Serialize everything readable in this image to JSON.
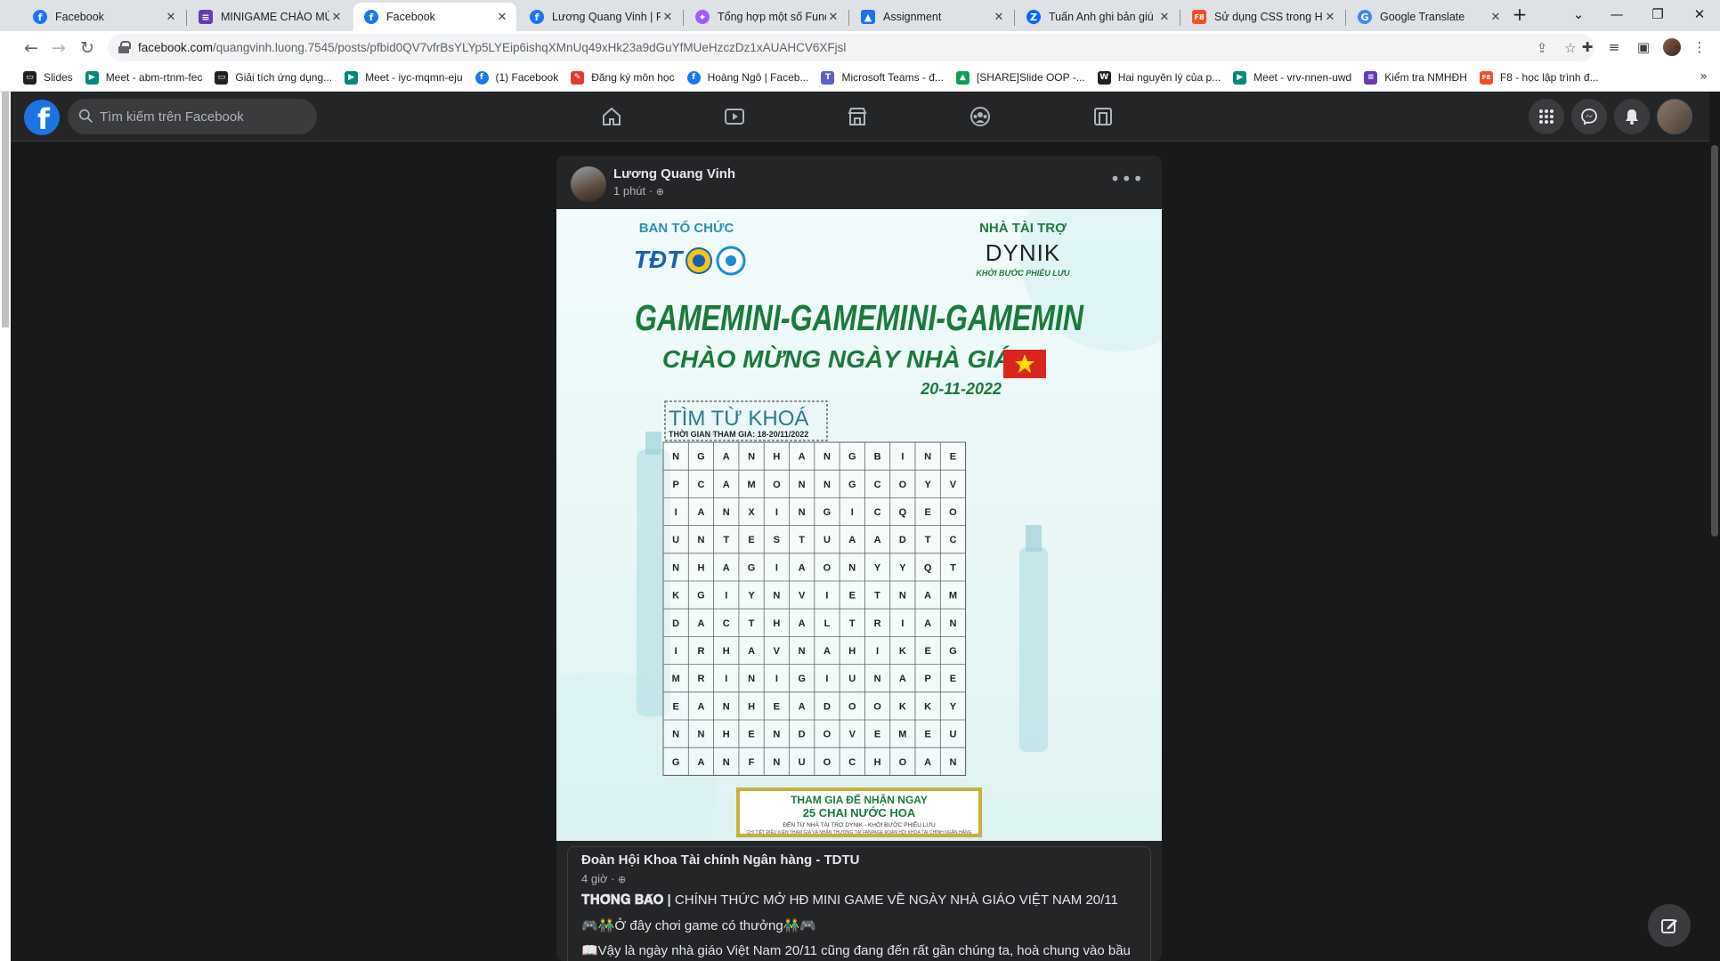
{
  "browser": {
    "tabs": [
      {
        "title": "Facebook",
        "icon": "facebook-icon",
        "color": "#1877f2"
      },
      {
        "title": "MINIGAME CHÀO MỪ",
        "icon": "form-icon",
        "color": "#673ab7"
      },
      {
        "title": "Facebook",
        "icon": "facebook-icon",
        "color": "#1877f2",
        "active": true
      },
      {
        "title": "Lương Quang Vinh | Fa",
        "icon": "facebook-icon",
        "color": "#1877f2"
      },
      {
        "title": "Tổng hợp một số Func",
        "icon": "figma-icon",
        "color": "#a259ff"
      },
      {
        "title": "Assignment",
        "icon": "classroom-icon",
        "color": "#1a73e8"
      },
      {
        "title": "Tuấn Anh ghi bản giú",
        "icon": "zalo-icon",
        "color": "#0068ff"
      },
      {
        "title": "Sử dụng CSS trong HT",
        "icon": "f8-icon",
        "color": "#f05123"
      },
      {
        "title": "Google Translate",
        "icon": "translate-icon",
        "color": "#4285f4"
      }
    ],
    "new_tab_label": "+",
    "url_host": "facebook.com",
    "url_path": "/quangvinh.luong.7545/posts/pfbid0QV7vfrBsYLYp5LYEip6ishqXMnUq49xHk23a9dGuYfMUeHzczDz1xAUAHCV6XFjsl",
    "bookmarks": [
      {
        "label": "Slides",
        "icon": "slides-icon",
        "color": "#202124"
      },
      {
        "label": "Meet - abm-rtnm-fec",
        "icon": "meet-icon",
        "color": "#00897b"
      },
      {
        "label": "Giải tích ứng dụng...",
        "icon": "slides-icon",
        "color": "#202124"
      },
      {
        "label": "Meet - iyc-mqmn-eju",
        "icon": "meet-icon",
        "color": "#00897b"
      },
      {
        "label": "(1) Facebook",
        "icon": "facebook-icon",
        "color": "#1877f2"
      },
      {
        "label": "Đăng ký môn học",
        "icon": "register-icon",
        "color": "#e53935"
      },
      {
        "label": "Hoàng Ngô | Faceb...",
        "icon": "facebook-icon",
        "color": "#1877f2"
      },
      {
        "label": "Microsoft Teams - đ...",
        "icon": "teams-icon",
        "color": "#5b5fc7"
      },
      {
        "label": "[SHARE]Slide OOP -...",
        "icon": "drive-icon",
        "color": "#0f9d58"
      },
      {
        "label": "Hai nguyên lý của p...",
        "icon": "wikipedia-icon",
        "color": "#202124"
      },
      {
        "label": "Meet - vrv-nnen-uwd",
        "icon": "meet-icon",
        "color": "#00897b"
      },
      {
        "label": "Kiểm tra NMHĐH",
        "icon": "form-icon",
        "color": "#673ab7"
      },
      {
        "label": "F8 - học lập trình đ...",
        "icon": "f8-icon",
        "color": "#f05123"
      }
    ]
  },
  "facebook": {
    "search_placeholder": "Tìm kiếm trên Facebook"
  },
  "post": {
    "author": "Lương Quang Vinh",
    "time": "1 phút · ",
    "shared": {
      "author": "Đoàn Hội Khoa Tài chính Ngân hàng - TDTU",
      "time": "4 giờ · ",
      "line1_bold": "𝐓𝐇𝐎̂𝐍𝐆 𝐁𝐀́𝐎 |",
      "line1_rest": " CHÍNH THỨC MỞ HĐ MINI GAME VỀ NGÀY NHÀ GIÁO VIỆT NAM 20/11",
      "line2": "🎮👬Ở đây chơi game có thưởng👬🎮",
      "line3": "📖Vậy là ngày nhà giáo Việt Nam 20/11 cũng đang đến rất gần chúng ta, hoà chung vào bầu"
    }
  },
  "poster": {
    "organizer_label": "BAN TỔ CHỨC",
    "sponsor_label": "NHÀ TÀI TRỢ",
    "sponsor_brand": "DYNIK",
    "sponsor_slogan": "KHỞI BƯỚC PHIÊU LƯU",
    "banner": "GAMEMINI-GAMEMINI-GAMEMIN",
    "subtitle": "CHÀO MỪNG NGÀY NHÀ GIÁO",
    "date": "20-11-2022",
    "puzzle_title": "TÌM TỪ KHOÁ",
    "puzzle_time": "THỜI GIAN THAM GIA: 18-20/11/2022",
    "grid": [
      [
        "N",
        "G",
        "A",
        "N",
        "H",
        "A",
        "N",
        "G",
        "B",
        "I",
        "N",
        "E"
      ],
      [
        "P",
        "C",
        "A",
        "M",
        "O",
        "N",
        "N",
        "G",
        "C",
        "O",
        "Y",
        "V"
      ],
      [
        "I",
        "A",
        "N",
        "X",
        "I",
        "N",
        "G",
        "I",
        "C",
        "Q",
        "E",
        "O"
      ],
      [
        "U",
        "N",
        "T",
        "E",
        "S",
        "T",
        "U",
        "A",
        "A",
        "D",
        "T",
        "C"
      ],
      [
        "N",
        "H",
        "A",
        "G",
        "I",
        "A",
        "O",
        "N",
        "Y",
        "Y",
        "Q",
        "T"
      ],
      [
        "K",
        "G",
        "I",
        "Y",
        "N",
        "V",
        "I",
        "E",
        "T",
        "N",
        "A",
        "M"
      ],
      [
        "D",
        "A",
        "C",
        "T",
        "H",
        "A",
        "L",
        "T",
        "R",
        "I",
        "A",
        "N"
      ],
      [
        "I",
        "R",
        "H",
        "A",
        "V",
        "N",
        "A",
        "H",
        "I",
        "K",
        "E",
        "G"
      ],
      [
        "M",
        "R",
        "I",
        "N",
        "I",
        "G",
        "I",
        "U",
        "N",
        "A",
        "P",
        "E"
      ],
      [
        "E",
        "A",
        "N",
        "H",
        "E",
        "A",
        "D",
        "O",
        "O",
        "K",
        "K",
        "Y"
      ],
      [
        "N",
        "N",
        "H",
        "E",
        "N",
        "D",
        "O",
        "V",
        "E",
        "M",
        "E",
        "U"
      ],
      [
        "G",
        "A",
        "N",
        "F",
        "N",
        "U",
        "O",
        "C",
        "H",
        "O",
        "A",
        "N"
      ]
    ],
    "prize_line1": "THAM GIA ĐỂ NHẬN NGAY",
    "prize_line2": "25 CHAI NƯỚC HOA",
    "prize_line3": "ĐẾN TỪ NHÀ TÀI TRỢ DYNIK - KHỞI BƯỚC PHIÊU LƯU",
    "prize_line4": "CHI TIẾT ĐIỀU KIỆN THAM GIA VÀ NHẬN THƯỞNG TẠI FANPAGE ĐOÀN HỘI KHOA TÀI CHÍNH NGÂN HÀNG"
  },
  "colors": {
    "fb_blue": "#1b74e4",
    "fb_surface": "#242526",
    "poster_green": "#1a7a3c",
    "poster_teal": "#2b9aa8"
  }
}
